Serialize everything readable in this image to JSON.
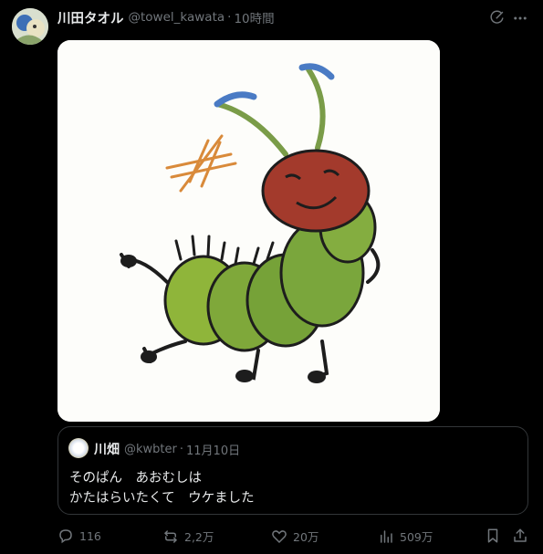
{
  "post": {
    "display_name": "川田タオル",
    "handle": "@towel_kawata",
    "separator": "·",
    "time": "10時間"
  },
  "quote": {
    "display_name": "川畑",
    "handle": "@kwbter",
    "separator": "·",
    "date": "11月10日",
    "text_line1": "そのぱん　あおむしは",
    "text_line2": "かたはらいたくて　ウケました"
  },
  "actions": {
    "replies": "116",
    "reposts": "2,2万",
    "likes": "20万",
    "views": "509万"
  },
  "icons": {
    "grok": "grok-icon",
    "more": "more-icon",
    "reply": "reply-icon",
    "repost": "repost-icon",
    "like": "heart-icon",
    "views": "views-icon",
    "bookmark": "bookmark-icon",
    "share": "share-icon"
  },
  "colors": {
    "background": "#000000",
    "primary_text": "#e7e9ea",
    "secondary_text": "#71767b",
    "border": "#333639"
  }
}
